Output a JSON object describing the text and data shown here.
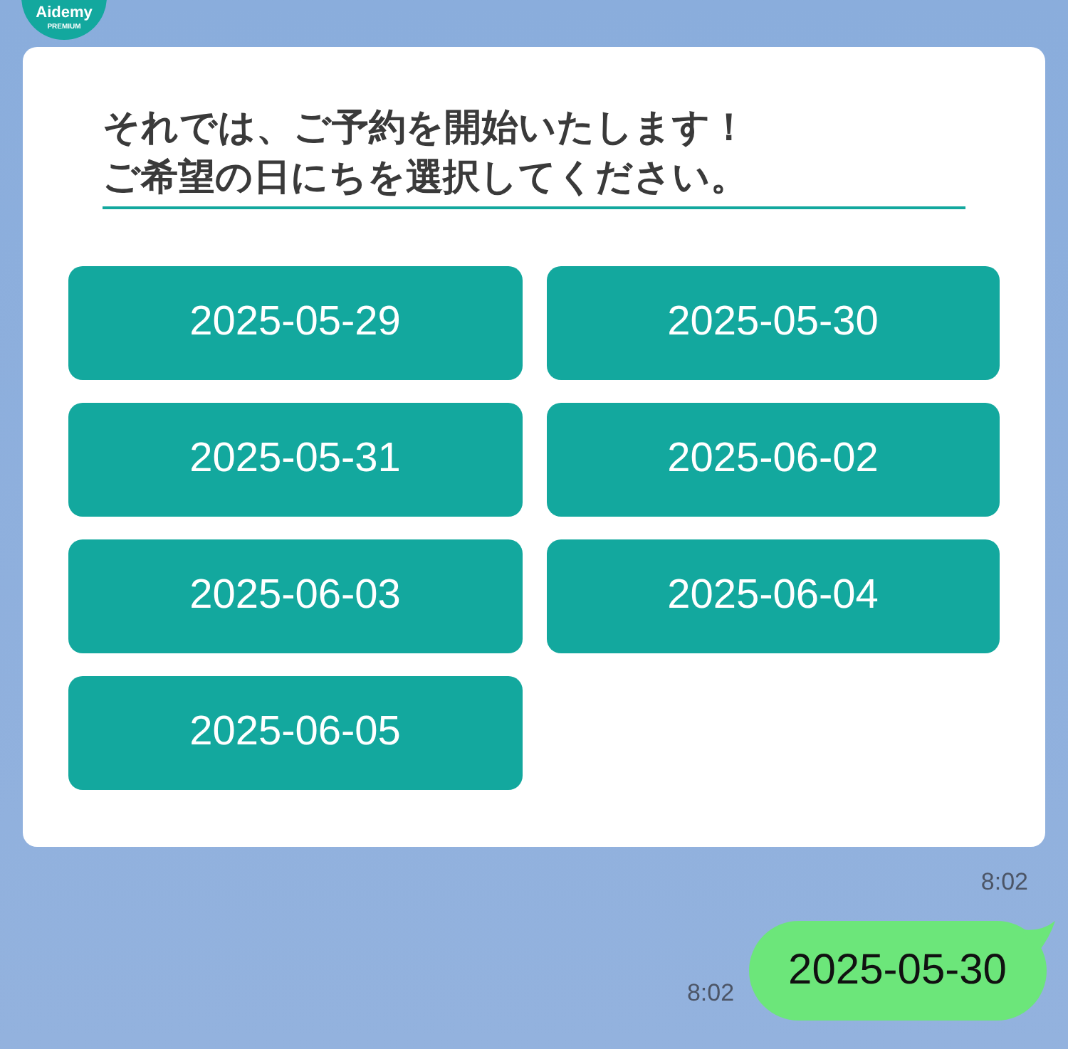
{
  "avatar": {
    "name": "Aidemy",
    "tagline": "PREMIUM"
  },
  "message": {
    "lines": [
      "それでは、ご予約を開始いたします！",
      "ご希望の日にちを選択してください。"
    ],
    "options": [
      "2025-05-29",
      "2025-05-30",
      "2025-05-31",
      "2025-06-02",
      "2025-06-03",
      "2025-06-04",
      "2025-06-05"
    ],
    "time": "8:02"
  },
  "reply": {
    "text": "2025-05-30",
    "time": "8:02"
  }
}
